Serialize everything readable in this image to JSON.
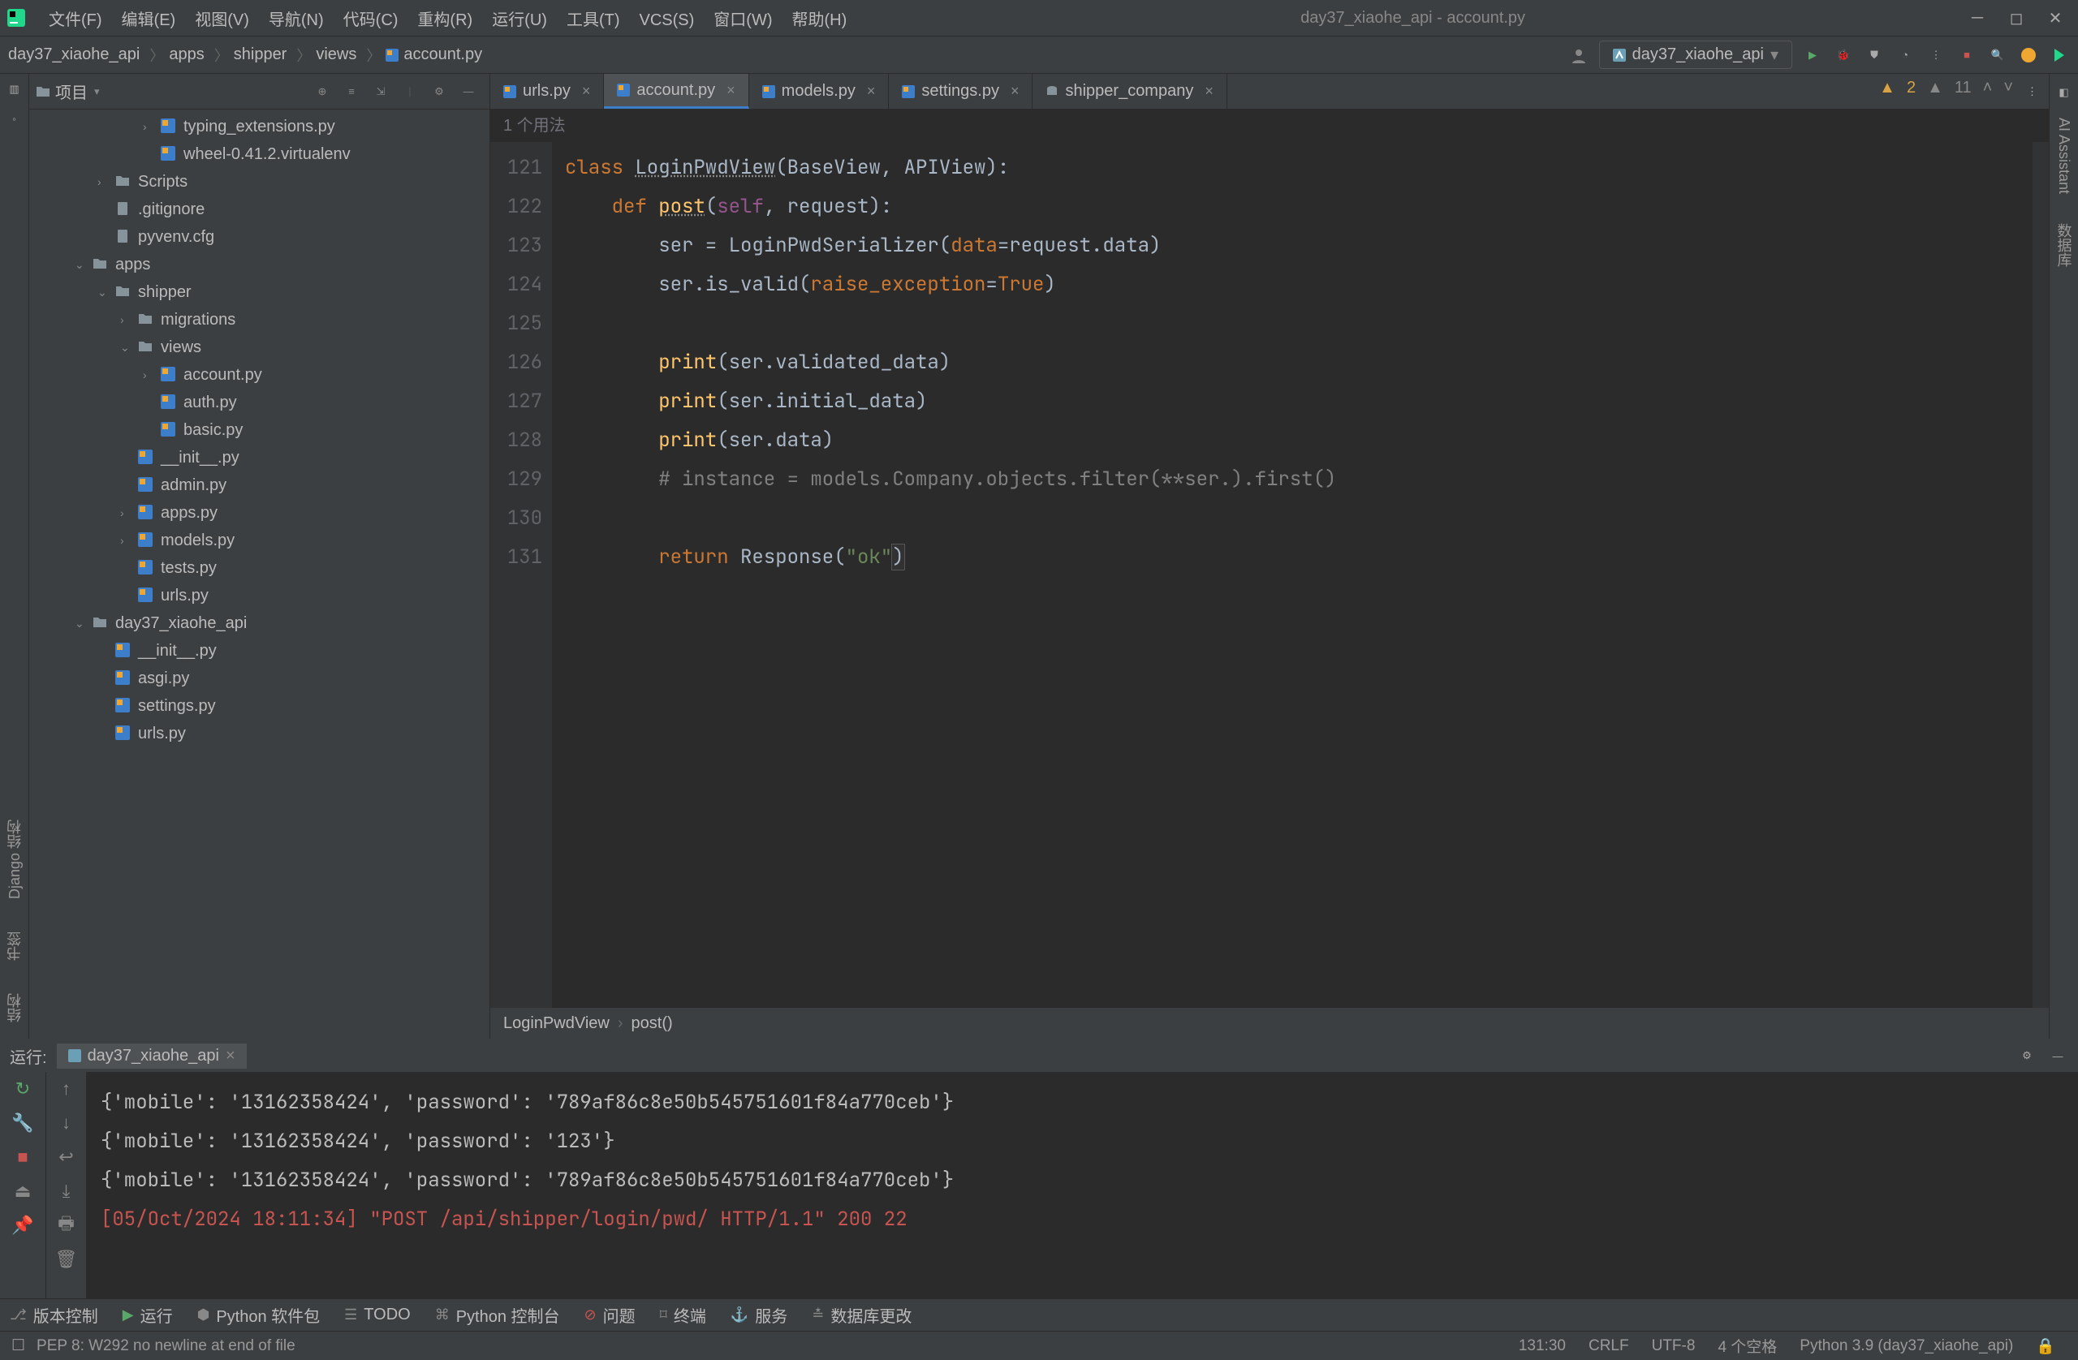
{
  "window": {
    "title": "day37_xiaohe_api - account.py"
  },
  "menu": [
    "文件(F)",
    "编辑(E)",
    "视图(V)",
    "导航(N)",
    "代码(C)",
    "重构(R)",
    "运行(U)",
    "工具(T)",
    "VCS(S)",
    "窗口(W)",
    "帮助(H)"
  ],
  "breadcrumbs": [
    "day37_xiaohe_api",
    "apps",
    "shipper",
    "views",
    "account.py"
  ],
  "run_config": "day37_xiaohe_api",
  "project_label": "项目",
  "tree": [
    {
      "indent": 5,
      "arrow": "›",
      "icon": "py",
      "label": "typing_extensions.py"
    },
    {
      "indent": 5,
      "arrow": "",
      "icon": "py",
      "label": "wheel-0.41.2.virtualenv"
    },
    {
      "indent": 3,
      "arrow": "›",
      "icon": "folder",
      "label": "Scripts"
    },
    {
      "indent": 3,
      "arrow": "",
      "icon": "file",
      "label": ".gitignore"
    },
    {
      "indent": 3,
      "arrow": "",
      "icon": "file",
      "label": "pyvenv.cfg"
    },
    {
      "indent": 2,
      "arrow": "⌄",
      "icon": "folder",
      "label": "apps"
    },
    {
      "indent": 3,
      "arrow": "⌄",
      "icon": "folder",
      "label": "shipper"
    },
    {
      "indent": 4,
      "arrow": "›",
      "icon": "folder",
      "label": "migrations"
    },
    {
      "indent": 4,
      "arrow": "⌄",
      "icon": "folder",
      "label": "views"
    },
    {
      "indent": 5,
      "arrow": "›",
      "icon": "py",
      "label": "account.py"
    },
    {
      "indent": 5,
      "arrow": "",
      "icon": "py",
      "label": "auth.py"
    },
    {
      "indent": 5,
      "arrow": "",
      "icon": "py",
      "label": "basic.py"
    },
    {
      "indent": 4,
      "arrow": "",
      "icon": "py",
      "label": "__init__.py"
    },
    {
      "indent": 4,
      "arrow": "",
      "icon": "py",
      "label": "admin.py"
    },
    {
      "indent": 4,
      "arrow": "›",
      "icon": "py",
      "label": "apps.py"
    },
    {
      "indent": 4,
      "arrow": "›",
      "icon": "py",
      "label": "models.py"
    },
    {
      "indent": 4,
      "arrow": "",
      "icon": "py",
      "label": "tests.py"
    },
    {
      "indent": 4,
      "arrow": "",
      "icon": "py",
      "label": "urls.py"
    },
    {
      "indent": 2,
      "arrow": "⌄",
      "icon": "folder",
      "label": "day37_xiaohe_api"
    },
    {
      "indent": 3,
      "arrow": "",
      "icon": "py",
      "label": "__init__.py"
    },
    {
      "indent": 3,
      "arrow": "",
      "icon": "py",
      "label": "asgi.py"
    },
    {
      "indent": 3,
      "arrow": "",
      "icon": "py",
      "label": "settings.py"
    },
    {
      "indent": 3,
      "arrow": "",
      "icon": "py",
      "label": "urls.py"
    }
  ],
  "editor_tabs": [
    {
      "label": "urls.py",
      "active": false
    },
    {
      "label": "account.py",
      "active": true
    },
    {
      "label": "models.py",
      "active": false
    },
    {
      "label": "settings.py",
      "active": false
    },
    {
      "label": "shipper_company",
      "active": false,
      "icon": "db"
    }
  ],
  "usage_hint": "1 个用法",
  "inspections": {
    "warn_strong": "2",
    "warn_weak": "11"
  },
  "code_lines": [
    {
      "n": 121,
      "html": "<span class='kw'>class</span> <span class='cls def-underline'>LoginPwdView</span>(BaseView, APIView):"
    },
    {
      "n": 122,
      "html": "    <span class='kw'>def</span> <span class='fn def-underline'>post</span>(<span class='self'>self</span>, request):"
    },
    {
      "n": 123,
      "html": "        ser = LoginPwdSerializer(<span class='param'>data</span>=request.data)"
    },
    {
      "n": 124,
      "html": "        ser.is_valid(<span class='param'>raise_exception</span>=<span class='bool'>True</span>)"
    },
    {
      "n": 125,
      "html": ""
    },
    {
      "n": 126,
      "html": "        <span class='fn'>print</span>(ser.validated_data)"
    },
    {
      "n": 127,
      "html": "        <span class='fn'>print</span>(ser.initial_data)"
    },
    {
      "n": 128,
      "html": "        <span class='fn'>print</span>(ser.data)"
    },
    {
      "n": 129,
      "html": "        <span class='comment'># instance = models.Company.objects.filter(**ser.).first()</span>"
    },
    {
      "n": 130,
      "html": ""
    },
    {
      "n": 131,
      "html": "        <span class='kw'>return</span> Response(<span class='str'>\"ok\"</span><span class='cursor-box'>)</span>"
    }
  ],
  "code_crumbs": [
    "LoginPwdView",
    "post()"
  ],
  "run": {
    "label": "运行:",
    "tab": "day37_xiaohe_api",
    "lines": [
      "{'mobile': '13162358424', 'password': '789af86c8e50b545751601f84a770ceb'}",
      "{'mobile': '13162358424', 'password': '123'}",
      "{'mobile': '13162358424', 'password': '789af86c8e50b545751601f84a770ceb'}"
    ],
    "http": "[05/Oct/2024 18:11:34] \"POST /api/shipper/login/pwd/ HTTP/1.1\" 200 22"
  },
  "tool_windows": [
    {
      "icon": "branch",
      "label": "版本控制"
    },
    {
      "icon": "run",
      "label": "运行"
    },
    {
      "icon": "pkg",
      "label": "Python 软件包"
    },
    {
      "icon": "todo",
      "label": "TODO"
    },
    {
      "icon": "pyconsole",
      "label": "Python 控制台"
    },
    {
      "icon": "problem",
      "label": "问题"
    },
    {
      "icon": "terminal",
      "label": "终端"
    },
    {
      "icon": "service",
      "label": "服务"
    },
    {
      "icon": "db",
      "label": "数据库更改"
    }
  ],
  "status": {
    "msg": "PEP 8: W292 no newline at end of file",
    "pos": "131:30",
    "eol": "CRLF",
    "enc": "UTF-8",
    "indent": "4 个空格",
    "interp": "Python 3.9 (day37_xiaohe_api)"
  },
  "left_tabs": [
    "项目"
  ],
  "right_tabs": [
    "AI Assistant",
    "数据库"
  ],
  "left_bottom_tabs": [
    "Django 结构",
    "书签",
    "结构"
  ]
}
